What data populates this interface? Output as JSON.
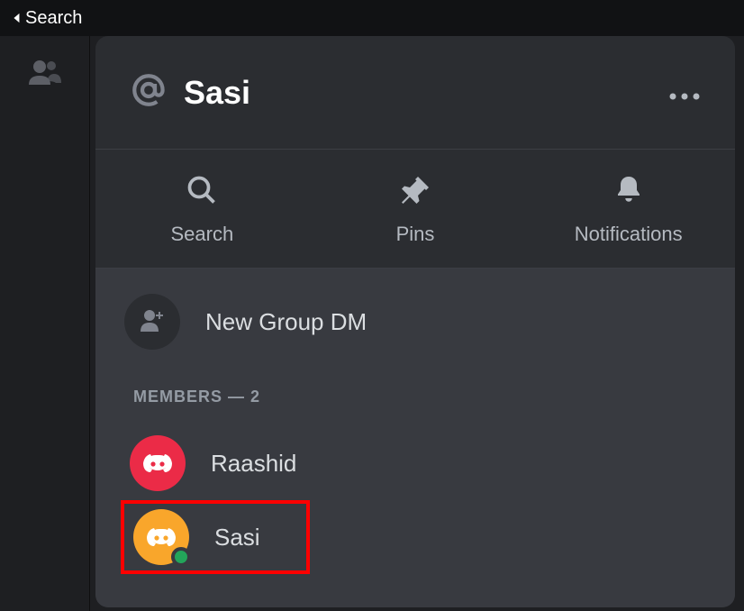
{
  "topbar": {
    "back_label": "Search"
  },
  "panel": {
    "title": "Sasi"
  },
  "actions": {
    "search": "Search",
    "pins": "Pins",
    "notifications": "Notifications"
  },
  "new_group": {
    "label": "New Group DM"
  },
  "members": {
    "heading": "MEMBERS — 2",
    "list": [
      {
        "name": "Raashid",
        "color": "red",
        "online": false
      },
      {
        "name": "Sasi",
        "color": "orange",
        "online": true
      }
    ]
  }
}
